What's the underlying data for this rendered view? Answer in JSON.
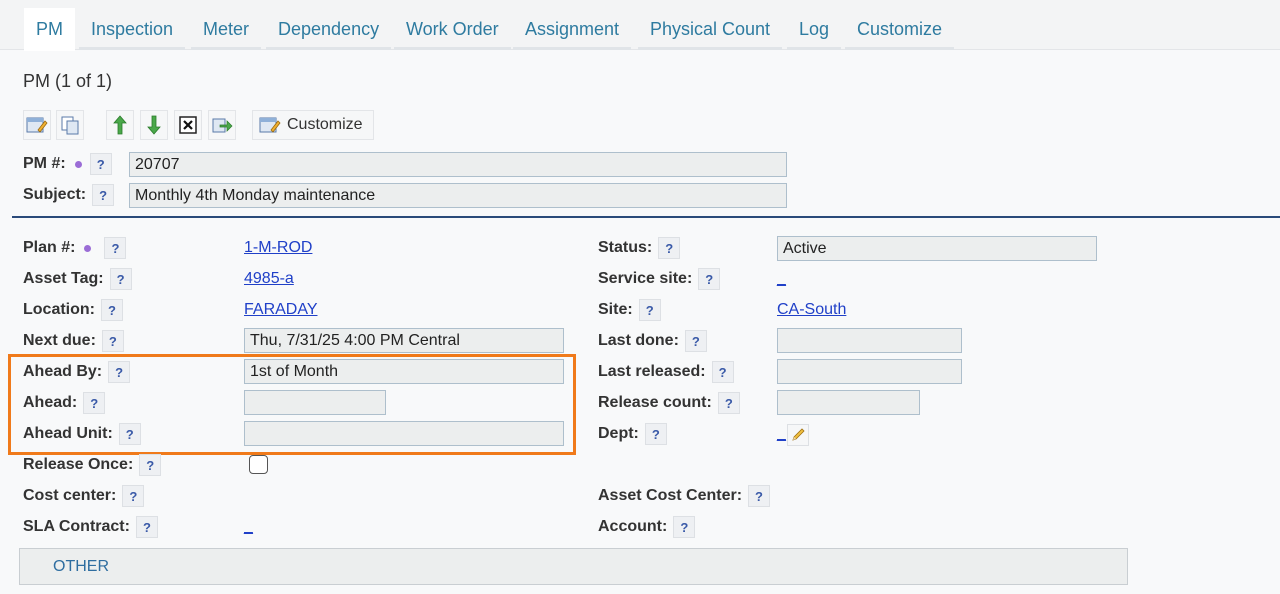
{
  "tabs": [
    {
      "label": "PM",
      "active": true
    },
    {
      "label": "Inspection"
    },
    {
      "label": "Meter"
    },
    {
      "label": "Dependency"
    },
    {
      "label": "Work Order"
    },
    {
      "label": "Assignment"
    },
    {
      "label": "Physical Count"
    },
    {
      "label": "Log"
    },
    {
      "label": "Customize"
    }
  ],
  "page": {
    "title": "PM (1 of 1)"
  },
  "toolbar": {
    "customize_label": "Customize",
    "icons": [
      "edit-icon",
      "copy-icon",
      "move-up-icon",
      "move-down-icon",
      "delete-icon",
      "export-icon"
    ]
  },
  "help_glyph": "?",
  "header_fields": {
    "pm_number": {
      "label": "PM #:",
      "value": "20707"
    },
    "subject": {
      "label": "Subject:",
      "value": "Monthly 4th Monday maintenance"
    }
  },
  "left": {
    "plan": {
      "label": "Plan #:",
      "value": "1-M-ROD"
    },
    "asset_tag": {
      "label": "Asset Tag:",
      "value": "4985-a"
    },
    "location": {
      "label": "Location:",
      "value": "FARADAY"
    },
    "next_due": {
      "label": "Next due:",
      "value": "Thu, 7/31/25 4:00 PM Central"
    },
    "ahead_by": {
      "label": "Ahead By:",
      "value": "1st of Month"
    },
    "ahead": {
      "label": "Ahead:",
      "value": ""
    },
    "ahead_unit": {
      "label": "Ahead Unit:",
      "value": ""
    },
    "release_once": {
      "label": "Release Once:",
      "checked": false
    },
    "cost_center": {
      "label": "Cost center:",
      "value": ""
    },
    "sla_contract": {
      "label": "SLA Contract:",
      "value": "_"
    }
  },
  "right": {
    "status": {
      "label": "Status:",
      "value": "Active"
    },
    "service_site": {
      "label": "Service site:",
      "value": "_"
    },
    "site": {
      "label": "Site:",
      "value": "CA-South"
    },
    "last_done": {
      "label": "Last done:",
      "value": ""
    },
    "last_released": {
      "label": "Last released:",
      "value": ""
    },
    "release_count": {
      "label": "Release count:",
      "value": ""
    },
    "dept": {
      "label": "Dept:",
      "value": "_"
    },
    "asset_cost_center": {
      "label": "Asset Cost Center:",
      "value": ""
    },
    "account": {
      "label": "Account:",
      "value": ""
    }
  },
  "section": {
    "other_label": "OTHER"
  },
  "colors": {
    "highlight": "#f07a1a",
    "link": "#2040c8",
    "tab_text": "#2e7ba0",
    "required_dot": "#9b6dd6"
  }
}
